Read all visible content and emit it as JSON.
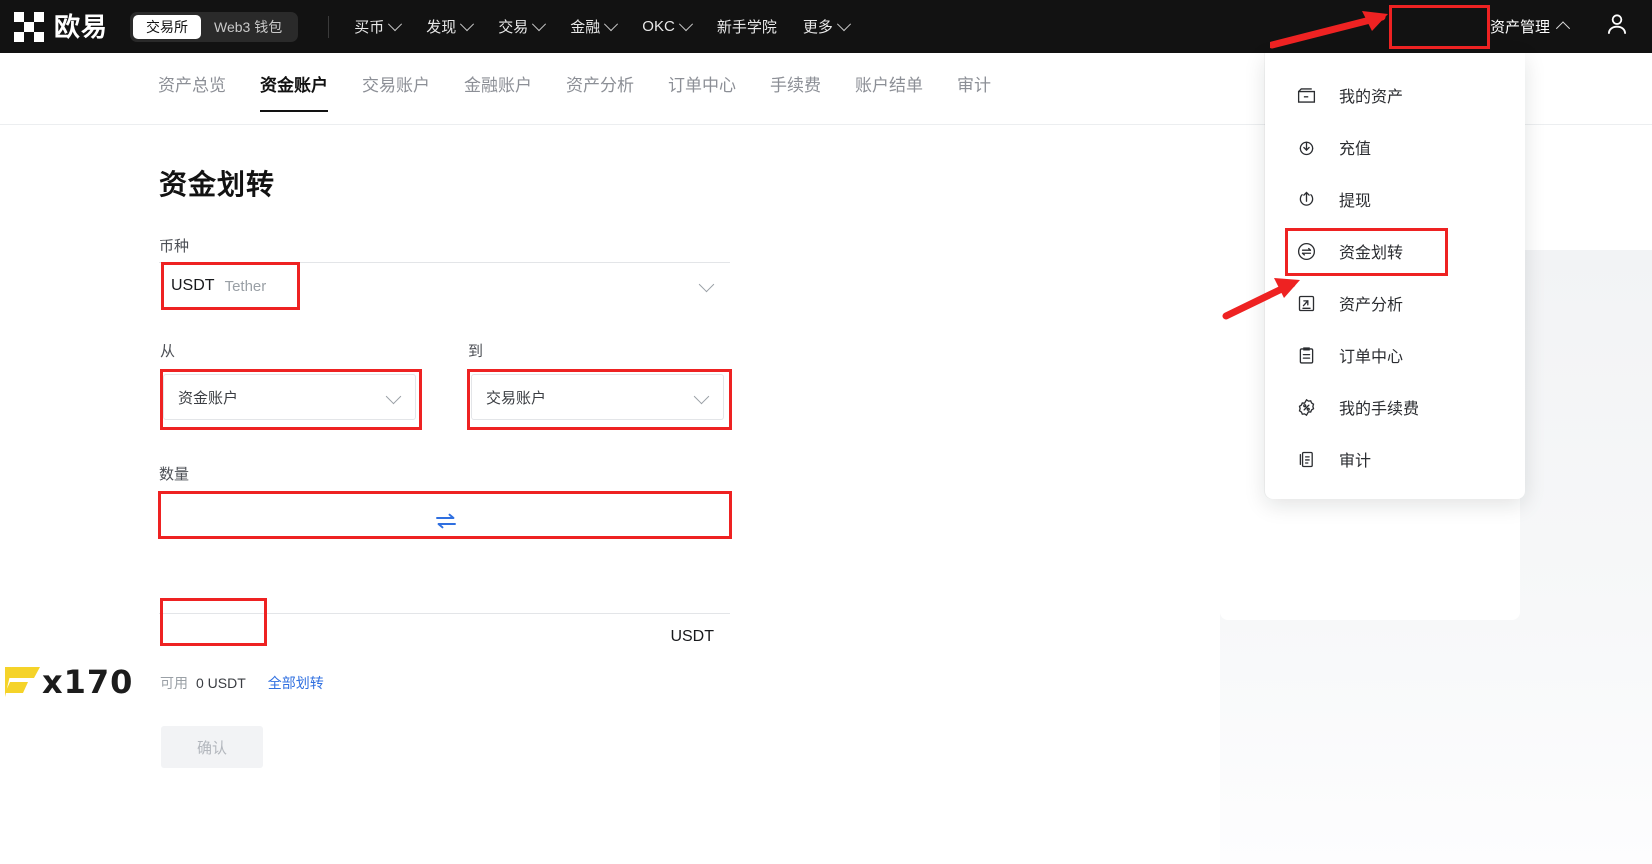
{
  "topbar": {
    "brand_name": "欧易",
    "segments": [
      {
        "label": "交易所",
        "active": true
      },
      {
        "label": "Web3 钱包",
        "active": false
      }
    ],
    "nav": [
      {
        "label": "买币",
        "caret": true
      },
      {
        "label": "发现",
        "caret": true
      },
      {
        "label": "交易",
        "caret": true
      },
      {
        "label": "金融",
        "caret": true
      },
      {
        "label": "OKC",
        "caret": true
      },
      {
        "label": "新手学院",
        "caret": false
      },
      {
        "label": "更多",
        "caret": true
      }
    ],
    "asset_management": "资产管理",
    "user_icon": "user-avatar-icon"
  },
  "subtabs": [
    {
      "label": "资产总览",
      "active": false
    },
    {
      "label": "资金账户",
      "active": true
    },
    {
      "label": "交易账户",
      "active": false
    },
    {
      "label": "金融账户",
      "active": false
    },
    {
      "label": "资产分析",
      "active": false
    },
    {
      "label": "订单中心",
      "active": false
    },
    {
      "label": "手续费",
      "active": false
    },
    {
      "label": "账户结单",
      "active": false
    },
    {
      "label": "审计",
      "active": false
    }
  ],
  "main": {
    "page_title": "资金划转",
    "currency": {
      "label": "币种",
      "code": "USDT",
      "name": "Tether"
    },
    "from": {
      "label": "从",
      "value": "资金账户"
    },
    "to": {
      "label": "到",
      "value": "交易账户"
    },
    "swap_icon": "swap-arrows-icon",
    "amount": {
      "label": "数量",
      "value": "",
      "placeholder": "",
      "unit": "USDT"
    },
    "available": {
      "label": "可用",
      "value": "0 USDT",
      "all_link": "全部划转"
    },
    "confirm_button": "确认"
  },
  "dropdown": {
    "items": [
      {
        "label": "我的资产",
        "icon": "wallet-icon",
        "highlighted": false
      },
      {
        "label": "充值",
        "icon": "deposit-down-arrow-icon",
        "highlighted": false
      },
      {
        "label": "提现",
        "icon": "withdraw-up-arrow-icon",
        "highlighted": false
      },
      {
        "label": "资金划转",
        "icon": "transfer-circle-icon",
        "highlighted": true
      },
      {
        "label": "资产分析",
        "icon": "analysis-chart-icon",
        "highlighted": false
      },
      {
        "label": "订单中心",
        "icon": "clipboard-icon",
        "highlighted": false
      },
      {
        "label": "我的手续费",
        "icon": "fee-badge-icon",
        "highlighted": false
      },
      {
        "label": "审计",
        "icon": "audit-doc-icon",
        "highlighted": false
      }
    ]
  },
  "watermark": {
    "text": "x170",
    "mark_icon": "yellow-f-logo-icon"
  },
  "colors": {
    "annotation_red": "#ee2222",
    "topbar_bg": "#121212",
    "link_blue": "#2f6fe0",
    "swap_blue": "#2f6fe0",
    "watermark_yellow": "#f5d329"
  }
}
